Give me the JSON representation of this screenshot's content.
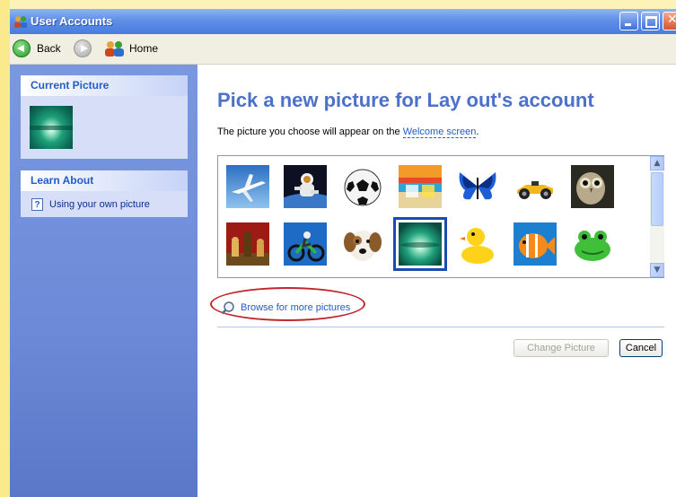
{
  "window": {
    "title": "User Accounts"
  },
  "toolbar": {
    "back_label": "Back",
    "home_label": "Home"
  },
  "sidebar": {
    "current_picture_header": "Current Picture",
    "learn_about_header": "Learn About",
    "learn_items": [
      {
        "label": "Using your own picture",
        "icon": "help-icon"
      }
    ]
  },
  "main": {
    "heading": "Pick a new picture for Lay out's account",
    "description_prefix": "The picture you choose will appear on the ",
    "description_link": "Welcome screen",
    "description_suffix": ".",
    "pictures": [
      {
        "name": "airplane"
      },
      {
        "name": "astronaut"
      },
      {
        "name": "soccer-ball"
      },
      {
        "name": "beach-chairs"
      },
      {
        "name": "butterfly"
      },
      {
        "name": "race-car"
      },
      {
        "name": "owl"
      },
      {
        "name": "chess-pieces"
      },
      {
        "name": "dirt-bike"
      },
      {
        "name": "dog"
      },
      {
        "name": "drip",
        "selected": true
      },
      {
        "name": "rubber-duck"
      },
      {
        "name": "fish"
      },
      {
        "name": "frog"
      }
    ],
    "browse_label": "Browse for more pictures",
    "change_button": "Change Picture",
    "cancel_button": "Cancel"
  },
  "colors": {
    "accent_blue": "#215dc6",
    "heading_blue": "#4b71c9",
    "sidebar_blue": "#6d8ad8",
    "annotation_red": "#c0272d",
    "selection_blue": "#1a4bb0"
  }
}
